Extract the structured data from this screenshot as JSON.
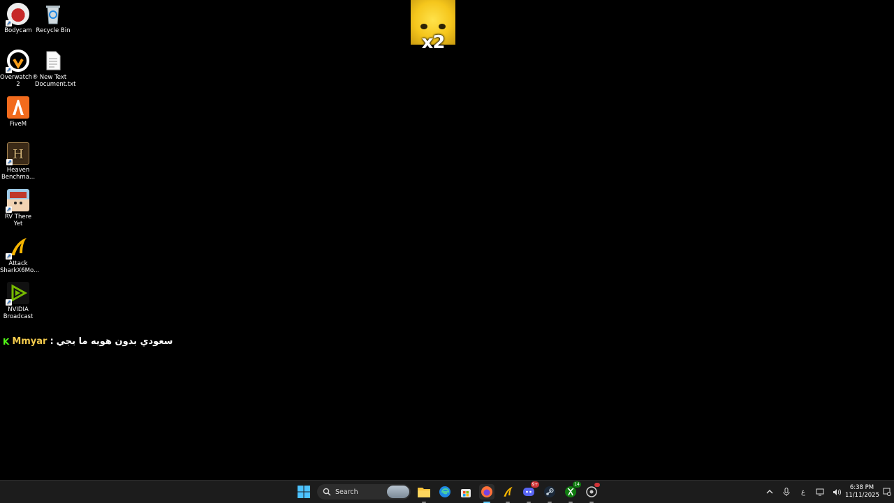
{
  "desktop": {
    "icons": [
      {
        "label": "Bodycam",
        "icon": "bodycam-icon"
      },
      {
        "label": "Recycle Bin",
        "icon": "recycle-bin-icon"
      },
      {
        "label": "Overwatch® 2",
        "icon": "overwatch-icon"
      },
      {
        "label": "New Text Document.txt",
        "icon": "text-document-icon"
      },
      {
        "label": "FiveM",
        "icon": "fivem-icon"
      },
      {
        "label": "Heaven Benchma...",
        "icon": "heaven-benchmark-icon"
      },
      {
        "label": "RV There Yet",
        "icon": "rv-there-yet-icon"
      },
      {
        "label": "Attack SharkX6Mo...",
        "icon": "attack-shark-icon"
      },
      {
        "label": "NVIDIA Broadcast",
        "icon": "nvidia-broadcast-icon"
      }
    ]
  },
  "overlay": {
    "multiplier": "x2"
  },
  "chat": {
    "platform_glyph": "K",
    "username": "Mmyar",
    "separator": ":",
    "message": "سعودي بدون هويه ما يجي"
  },
  "taskbar": {
    "search_label": "Search",
    "apps": [
      {
        "name": "file-explorer-icon"
      },
      {
        "name": "edge-icon"
      },
      {
        "name": "store-icon"
      },
      {
        "name": "firefox-icon"
      },
      {
        "name": "attack-shark-icon"
      },
      {
        "name": "discord-icon",
        "badge": "9+"
      },
      {
        "name": "steam-icon"
      },
      {
        "name": "xbox-icon",
        "badge": "14"
      },
      {
        "name": "chrome-like-icon"
      }
    ],
    "tray": {
      "keyboard_lang": "ع",
      "time": "6:38 PM",
      "date": "11/11/2025"
    }
  },
  "colors": {
    "kick_green": "#53fc18",
    "username_yellow": "#f2c94c",
    "taskbar_bg": "#1c1c1c"
  }
}
